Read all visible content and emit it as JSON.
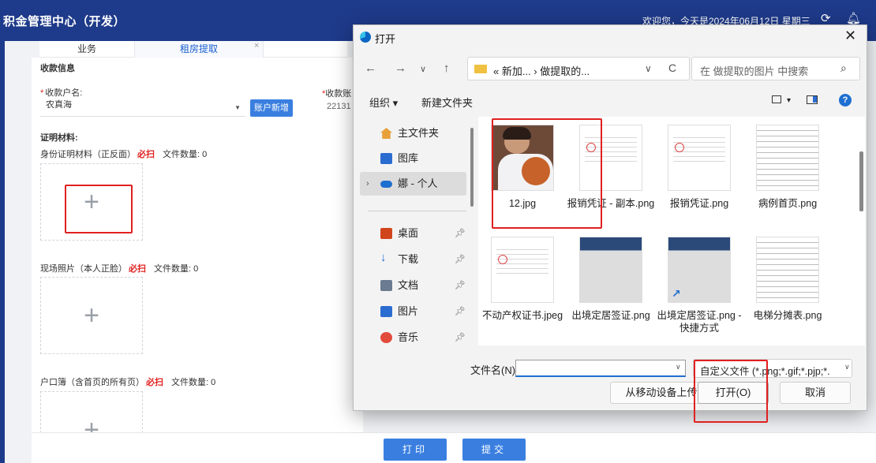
{
  "app": {
    "title": "积金管理中心（开发）",
    "welcome": "欢迎您，今天是2024年06月12日 星期三",
    "refresh_icon": "refresh-icon",
    "bell_icon": "bell-icon"
  },
  "tabs": [
    {
      "label": "业务"
    },
    {
      "label": "租房提取"
    }
  ],
  "tab_close": "×",
  "form": {
    "section_receipt": "收款信息",
    "payee_label": "收款户名:",
    "payee_value": "农真海",
    "new_account_button": "账户新增",
    "account_label": "收款账",
    "account_value": "22131",
    "section_docs": "证明材料:"
  },
  "documents": [
    {
      "label": "身份证明材料（正反面）",
      "must": "必扫",
      "count": "文件数量: 0"
    },
    {
      "label": "现场照片（本人正脸）",
      "must": "必扫",
      "count": "文件数量: 0"
    },
    {
      "label": "户口簿（含首页的所有页）",
      "must": "必扫",
      "count": "文件数量: 0"
    }
  ],
  "bottom_buttons": {
    "print": "打印",
    "submit": "提交"
  },
  "dialog": {
    "title": "打开",
    "close": "✕",
    "path": "« 新加... › 做提取的...",
    "search_placeholder": "在 做提取的图片 中搜索",
    "organize": "组织 ▾",
    "new_folder": "新建文件夹",
    "sidebar": [
      {
        "label": "主文件夹",
        "icon": "home-icon",
        "color": "#e8a13a"
      },
      {
        "label": "图库",
        "icon": "gallery-icon",
        "color": "#2b6cd0"
      },
      {
        "label": "娜 - 个人",
        "icon": "onedrive-icon",
        "color": "#1f6fd0"
      },
      {
        "label": "桌面",
        "icon": "desktop-icon",
        "color": "#d0451b"
      },
      {
        "label": "下载",
        "icon": "download-icon",
        "color": "#1f6fd0"
      },
      {
        "label": "文档",
        "icon": "documents-icon",
        "color": "#6b7b90"
      },
      {
        "label": "图片",
        "icon": "pictures-icon",
        "color": "#2b6cd0"
      },
      {
        "label": "音乐",
        "icon": "music-icon",
        "color": "#e24a3b"
      }
    ],
    "files": [
      {
        "name": "12.jpg",
        "kind": "photo"
      },
      {
        "name": "报销凭证 - 副本.png",
        "kind": "doc-red"
      },
      {
        "name": "报销凭证.png",
        "kind": "doc-red"
      },
      {
        "name": "病例首页.png",
        "kind": "doc"
      },
      {
        "name": "不动产权证书.jpeg",
        "kind": "doc-red"
      },
      {
        "name": "出境定居签证.png",
        "kind": "visa"
      },
      {
        "name": "出境定居签证.png - 快捷方式",
        "kind": "visa-shortcut"
      },
      {
        "name": "电梯分摊表.png",
        "kind": "table"
      }
    ],
    "filename_label": "文件名(N):",
    "filename_value": "",
    "filter": "自定义文件 (*.png;*.gif;*.pjp;*.",
    "upload_mobile": "从移动设备上传",
    "open": "打开(O)",
    "cancel": "取消"
  }
}
